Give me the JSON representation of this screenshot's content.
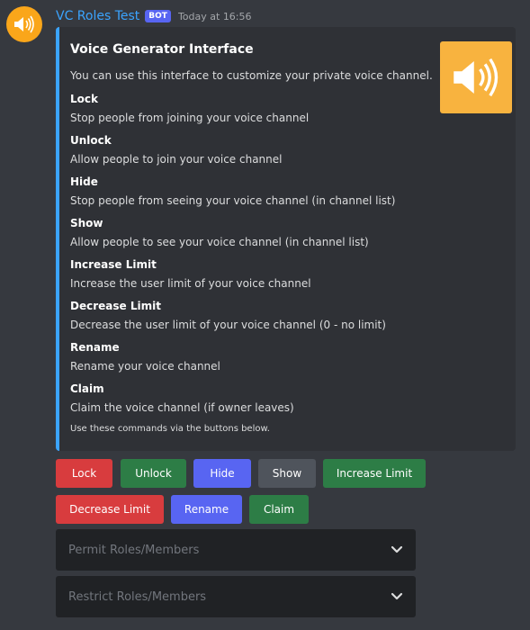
{
  "message": {
    "username": "VC Roles Test",
    "bot_tag": "BOT",
    "timestamp": "Today at 16:56",
    "avatar_icon": "speaker-icon"
  },
  "embed": {
    "accent_color": "#3ba4ff",
    "title": "Voice Generator Interface",
    "description": "You can use this interface to customize your private voice channel.",
    "thumbnail_icon": "speaker-icon",
    "fields": [
      {
        "name": "Lock",
        "value": "Stop people from joining your voice channel"
      },
      {
        "name": "Unlock",
        "value": "Allow people to join your voice channel"
      },
      {
        "name": "Hide",
        "value": "Stop people from seeing your voice channel (in channel list)"
      },
      {
        "name": "Show",
        "value": "Allow people to see your voice channel (in channel list)"
      },
      {
        "name": "Increase Limit",
        "value": "Increase the user limit of your voice channel"
      },
      {
        "name": "Decrease Limit",
        "value": "Decrease the user limit of your voice channel (0 - no limit)"
      },
      {
        "name": "Rename",
        "value": "Rename your voice channel"
      },
      {
        "name": "Claim",
        "value": "Claim the voice channel (if owner leaves)"
      }
    ],
    "footer": "Use these commands via the buttons below."
  },
  "buttons": {
    "row1": [
      {
        "label": "Lock",
        "style": "danger"
      },
      {
        "label": "Unlock",
        "style": "success"
      },
      {
        "label": "Hide",
        "style": "primary"
      },
      {
        "label": "Show",
        "style": "secondary"
      },
      {
        "label": "Increase Limit",
        "style": "success"
      }
    ],
    "row2": [
      {
        "label": "Decrease Limit",
        "style": "danger"
      },
      {
        "label": "Rename",
        "style": "primary"
      },
      {
        "label": "Claim",
        "style": "success"
      }
    ]
  },
  "selects": [
    {
      "placeholder": "Permit Roles/Members"
    },
    {
      "placeholder": "Restrict Roles/Members"
    }
  ]
}
